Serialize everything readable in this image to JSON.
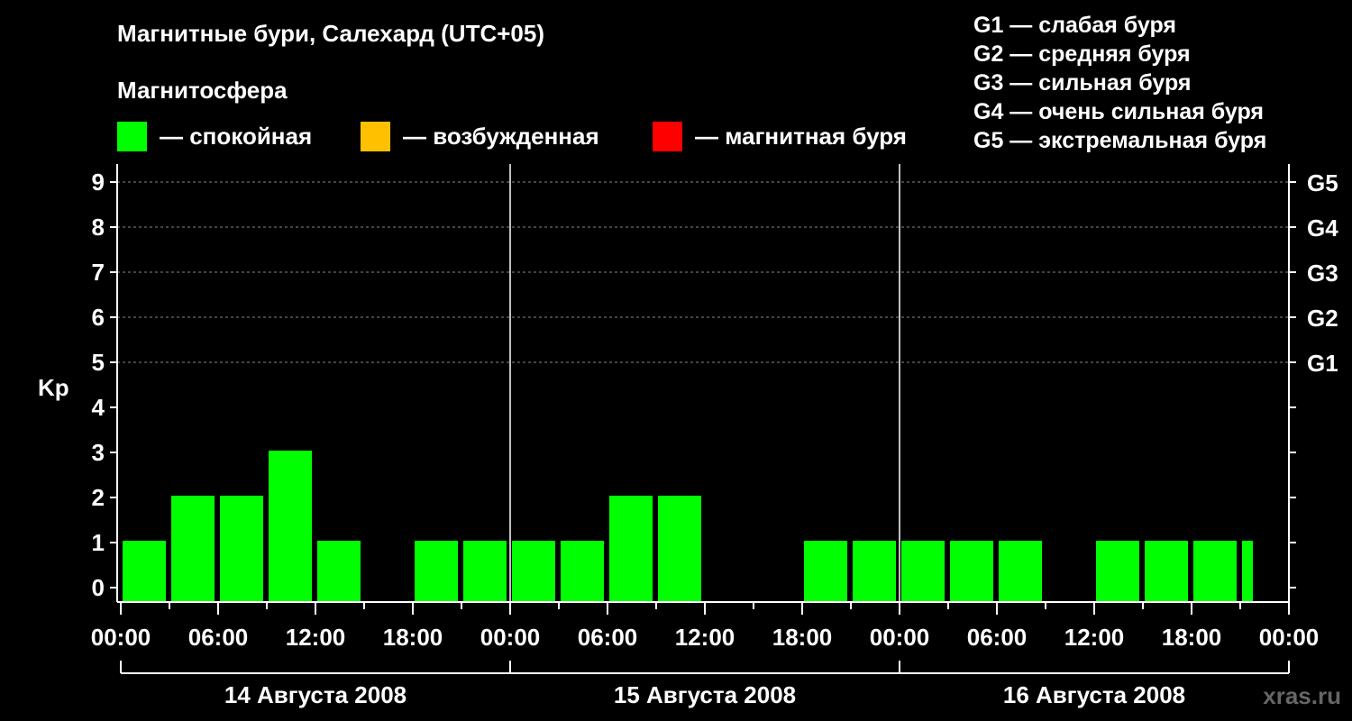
{
  "header": {
    "title": "Магнитные бури, Салехард (UTC+05)",
    "subtitle": "Магнитосфера"
  },
  "legend": {
    "items": [
      {
        "label": "— спокойная",
        "color": "#00ff00"
      },
      {
        "label": "— возбужденная",
        "color": "#ffc000"
      },
      {
        "label": "— магнитная буря",
        "color": "#ff0000"
      }
    ],
    "g_scale": [
      "G1 — слабая буря",
      "G2 — средняя буря",
      "G3 — сильная буря",
      "G4 — очень сильная буря",
      "G5 — экстремальная буря"
    ]
  },
  "chart_data": {
    "type": "bar",
    "ylabel": "Kp",
    "ylim": [
      0,
      9
    ],
    "yticks": [
      0,
      1,
      2,
      3,
      4,
      5,
      6,
      7,
      8,
      9
    ],
    "right_axis_labels": [
      {
        "kp": 5,
        "label": "G1"
      },
      {
        "kp": 6,
        "label": "G2"
      },
      {
        "kp": 7,
        "label": "G3"
      },
      {
        "kp": 8,
        "label": "G4"
      },
      {
        "kp": 9,
        "label": "G5"
      }
    ],
    "x_tick_labels": [
      "00:00",
      "06:00",
      "12:00",
      "18:00",
      "00:00",
      "06:00",
      "12:00",
      "18:00",
      "00:00",
      "06:00",
      "12:00",
      "18:00",
      "00:00"
    ],
    "interval_hours": 3,
    "days": [
      "14 Августа 2008",
      "15 Августа 2008",
      "16 Августа 2008"
    ],
    "values": [
      1,
      2,
      2,
      3,
      1,
      0,
      1,
      1,
      1,
      1,
      2,
      2,
      0,
      0,
      1,
      1,
      1,
      1,
      1,
      0,
      1,
      1,
      1,
      1
    ],
    "grid": "dashed horizontal",
    "bar_color": "#00ff00"
  },
  "footer": {
    "site": "xras.ru"
  }
}
